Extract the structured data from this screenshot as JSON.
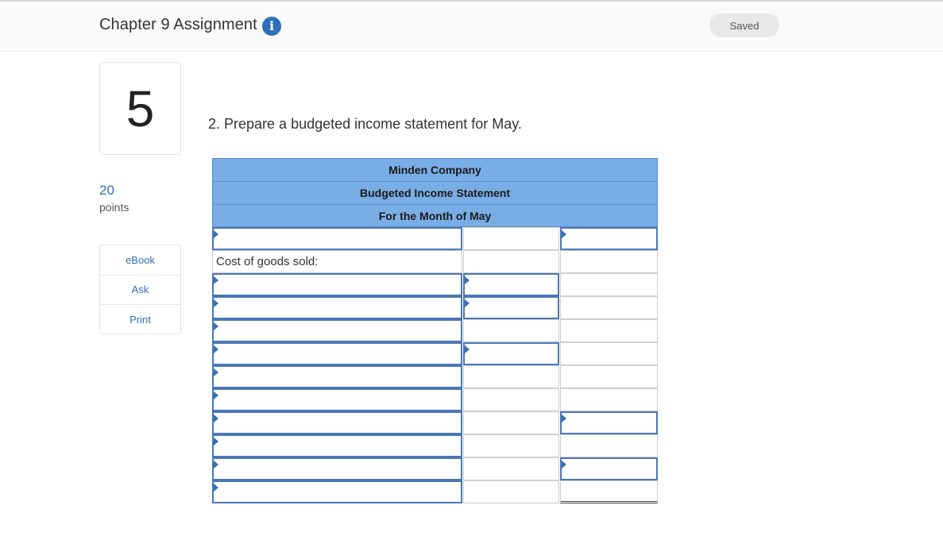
{
  "header": {
    "title": "Chapter 9 Assignment",
    "info_icon": "info-icon",
    "saved_label": "Saved"
  },
  "question": {
    "number": "5",
    "points_value": "20",
    "points_label": "points",
    "text": "2. Prepare a budgeted income statement for May."
  },
  "side_menu": {
    "items": [
      {
        "label": "eBook"
      },
      {
        "label": "Ask"
      },
      {
        "label": "Print"
      }
    ]
  },
  "statement": {
    "company": "Minden Company",
    "title": "Budgeted Income Statement",
    "period": "For the Month of May",
    "cost_of_goods_sold_label": "Cost of goods sold:"
  },
  "colors": {
    "header_blue": "#79ade6",
    "accent_blue": "#2f6fba",
    "input_border": "#4a78b6"
  }
}
